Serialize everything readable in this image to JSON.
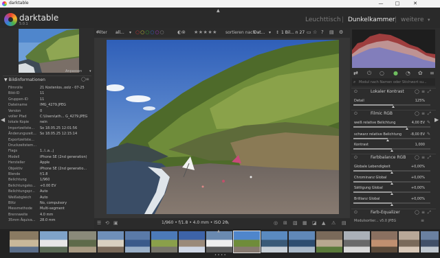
{
  "window": {
    "title": "darktable",
    "minimize": "—",
    "maximize": "□",
    "close": "✕"
  },
  "header": {
    "app_name": "darktable",
    "app_version": "5.0.1",
    "views": [
      "Leuchttisch",
      "Dunkelkammer",
      "weitere"
    ],
    "active_view": "Dunkelkammer",
    "more_arrow": "▾"
  },
  "left": {
    "navigation_label": "Anpassen",
    "info_header": "Bildinformationen",
    "info": [
      {
        "label": "Filmrolle",
        "value": "21 Kostenlos..oolz - 07-25"
      },
      {
        "label": "Bild-ID",
        "value": "11"
      },
      {
        "label": "Gruppen-ID",
        "value": "11"
      },
      {
        "label": "Dateiname",
        "value": "IMG_4279.JPEG"
      },
      {
        "label": "Version",
        "value": "0"
      },
      {
        "label": "voller Pfad",
        "value": "C:\\Users\\ath... G_4279.JPEG"
      },
      {
        "label": "lokale Kopie",
        "value": "nein"
      },
      {
        "label": "Importzeitste...",
        "value": "So 18.05.25 12:01:56"
      },
      {
        "label": "Änderungszeit...",
        "value": "So 18.05.25 12:15:14"
      },
      {
        "label": "Exportzeitste...",
        "value": ""
      },
      {
        "label": "Druckzeitstem...",
        "value": ""
      },
      {
        "label": "Flags",
        "value": "1..l..a...j"
      },
      {
        "label": "Modell",
        "value": "iPhone SE (2nd generation)"
      },
      {
        "label": "Hersteller",
        "value": "Apple"
      },
      {
        "label": "Objektiv",
        "value": "iPhone SE (2nd generatio..."
      },
      {
        "label": "Blende",
        "value": "f/1.8"
      },
      {
        "label": "Belichtung",
        "value": "1/960"
      },
      {
        "label": "Belichtungsko...",
        "value": "+0.00 EV"
      },
      {
        "label": "Belichtungspr...",
        "value": "Auto"
      },
      {
        "label": "Weißabgleich",
        "value": "Auto"
      },
      {
        "label": "Blitz",
        "value": "No, compulsory"
      },
      {
        "label": "Messmethode",
        "value": "Multi-segment"
      },
      {
        "label": "Brennweite",
        "value": "4.0 mm"
      },
      {
        "label": "35mm Äquiva...",
        "value": "28.0 mm"
      }
    ]
  },
  "filterbar": {
    "filter_label": "Filter",
    "filter_value": "all...",
    "stars": "★★★★★",
    "sort_label": "sortieren nach",
    "sort_value": "Dat...",
    "count": "1 Bil... n 27"
  },
  "center": {
    "exif_line": "1/960 • f/1.8 • 4.0 mm • ISO 20"
  },
  "right": {
    "search_placeholder": "Modul nach Namen oder Stichwort su...",
    "modules": [
      {
        "name": "Lokaler Kontrast"
      },
      {
        "name": "Filmic RGB"
      },
      {
        "name": "Farbbalance RGB"
      },
      {
        "name": "Farb-Equalizer"
      }
    ],
    "params": [
      {
        "label": "Detail",
        "value": "125%",
        "fill": 0.52
      },
      {
        "label": "weiß relative Belichtung",
        "value": "4,00 EV",
        "fill": 0.7
      },
      {
        "label": "schwarz relative Belichtung",
        "value": "-8,00 EV",
        "fill": 0.45
      },
      {
        "label": "Kontrast",
        "value": "1,000",
        "fill": 0.5
      },
      {
        "label": "Globale Lebendigkeit",
        "value": "+0,00%",
        "fill": 0.5
      },
      {
        "label": "Chrominanz Global",
        "value": "+0,00%",
        "fill": 0.5
      },
      {
        "label": "Sättigung Global",
        "value": "+0,00%",
        "fill": 0.5
      },
      {
        "label": "Brillianz Global",
        "value": "+0,00%",
        "fill": 0.5
      }
    ],
    "style_label": "Modulsortier... v5.0 JPEG"
  },
  "colors": {
    "accent": "#e8e8e8",
    "panel": "#2d2d2d",
    "image_bg": "#363636"
  }
}
